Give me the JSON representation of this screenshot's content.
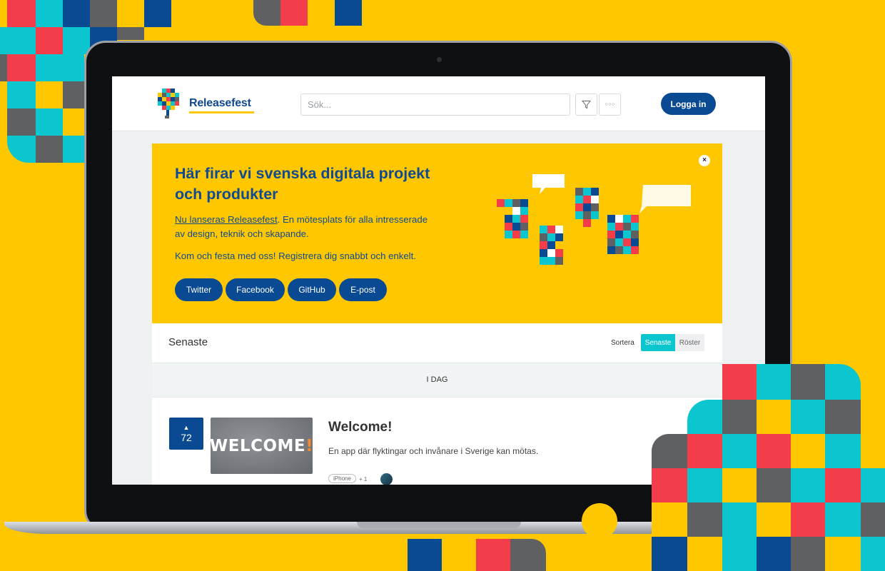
{
  "colors": {
    "yellow": "#ffc700",
    "blue": "#0a4a93",
    "cyan": "#0cc6cf",
    "red": "#f43d4a",
    "gray": "#5f6062"
  },
  "header": {
    "brand": "Releasefest",
    "search_placeholder": "Sök...",
    "filter_icon": "filter-icon",
    "more_icon": "more-dots-icon",
    "more_label": "○○○",
    "login": "Logga in"
  },
  "banner": {
    "headline": "Här firar vi svenska digitala projekt och produkter",
    "desc_link": "Nu lanseras Releasefest",
    "desc_rest": ". En mötesplats för alla intresserade av design, teknik och skapande.",
    "invite": "Kom och festa med oss! Registrera dig snabbt och enkelt.",
    "close": "×",
    "social": [
      "Twitter",
      "Facebook",
      "GitHub",
      "E-post"
    ]
  },
  "list": {
    "title": "Senaste",
    "sort_label": "Sortera",
    "sort_options": [
      "Senaste",
      "Röster"
    ],
    "day": "I DAG"
  },
  "post": {
    "vote_icon": "▲",
    "votes": "72",
    "thumb_text": "WELCOME",
    "thumb_bang": "!",
    "title": "Welcome!",
    "description": "En app där flyktingar och invånare i Sverige kan mötas.",
    "tag": "iPhone",
    "more": "+ 1"
  }
}
